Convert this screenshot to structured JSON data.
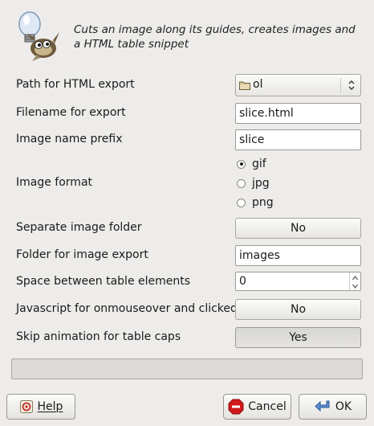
{
  "header": {
    "description": "Cuts an image along its guides, creates images and a HTML table snippet"
  },
  "fields": {
    "path_label": "Path for HTML export",
    "path_value": "ol",
    "filename_label": "Filename for export",
    "filename_value": "slice.html",
    "prefix_label": "Image name prefix",
    "prefix_value": "slice",
    "format_label": "Image format",
    "format_options": [
      "gif",
      "jpg",
      "png"
    ],
    "format_selected": "gif",
    "separate_folder_label": "Separate image folder",
    "separate_folder_value": "No",
    "folder_label": "Folder for image export",
    "folder_value": "images",
    "space_label": "Space between table elements",
    "space_value": "0",
    "js_label": "Javascript for onmouseover and clicked",
    "js_value": "No",
    "skip_label": "Skip animation for table caps",
    "skip_value": "Yes"
  },
  "progress": {
    "value": 0
  },
  "buttons": {
    "help": "Help",
    "cancel": "Cancel",
    "ok": "OK"
  },
  "colors": {
    "background": "#edecea",
    "cancel_icon": "#d0191b",
    "ok_icon": "#3a6fb5"
  }
}
